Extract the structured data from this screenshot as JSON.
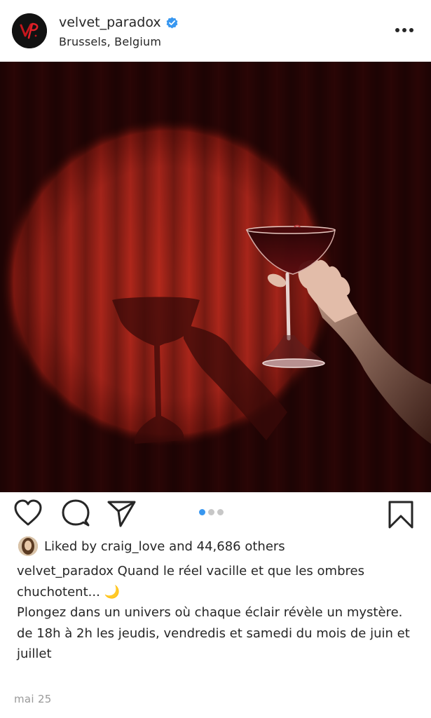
{
  "header": {
    "username": "velvet_paradox",
    "location": "Brussels, Belgium",
    "verified": true,
    "more_icon": "more-options-icon"
  },
  "post": {
    "image_subject": "hand raising a cocktail glass in a spotlight against a red curtain",
    "carousel": {
      "current": 1,
      "total": 3
    },
    "accent_color": "#3897f0"
  },
  "actions": {
    "like_icon": "heart-icon",
    "comment_icon": "comment-icon",
    "share_icon": "send-icon",
    "save_icon": "bookmark-icon"
  },
  "likes": {
    "prefix": "Liked by ",
    "liker": "craig_love",
    "suffix": " and 44,686 others"
  },
  "caption": {
    "author": "velvet_paradox",
    "line1": " Quand le réel vacille et que les ombres chuchotent... 🌙",
    "line2": "Plongez dans un univers où chaque éclair révèle un mystère.",
    "line3": "de 18h à 2h les jeudis, vendredis et samedi du mois de juin et juillet"
  },
  "date": "mai 25"
}
